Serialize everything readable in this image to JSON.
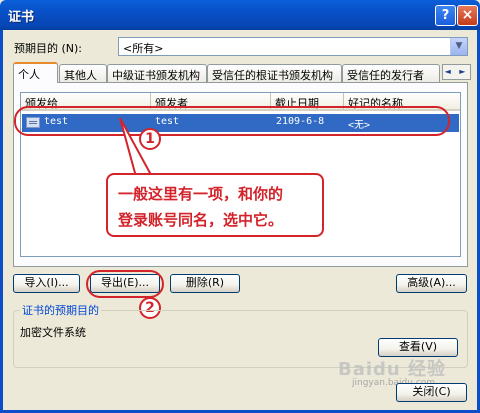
{
  "window": {
    "title": "证书",
    "help_glyph": "?",
    "close_glyph": "×"
  },
  "purpose": {
    "label": "预期目的 (N):",
    "selected": "<所有>"
  },
  "tabs": [
    {
      "label": "个人",
      "active": true
    },
    {
      "label": "其他人",
      "active": false
    },
    {
      "label": "中级证书颁发机构",
      "active": false
    },
    {
      "label": "受信任的根证书颁发机构",
      "active": false
    },
    {
      "label": "受信任的发行者",
      "active": false
    }
  ],
  "tab_scroll": "◄ ►",
  "list": {
    "columns": [
      "颁发给",
      "颁发者",
      "截止日期",
      "好记的名称"
    ],
    "rows": [
      {
        "issued_to": "test",
        "issued_by": "test",
        "expires": "2109-6-8",
        "friendly_name": "<无>"
      }
    ]
  },
  "annotations": {
    "badge1": "1",
    "badge2": "2",
    "callout_line1": "一般这里有一项，和你的",
    "callout_line2": "登录账号同名，选中它。"
  },
  "buttons": {
    "import": "导入(I)...",
    "export": "导出(E)...",
    "delete": "删除(R)",
    "advanced": "高级(A)...",
    "view": "查看(V)",
    "close": "关闭(C)"
  },
  "group": {
    "title": "证书的预期目的",
    "text": "加密文件系统"
  },
  "watermark": {
    "main": "Baidu 经验",
    "sub": "jingyan.baidu.com"
  },
  "colors": {
    "annotation": "#d3242b",
    "titlebar": "#0850c8",
    "selection": "#316ac5"
  }
}
